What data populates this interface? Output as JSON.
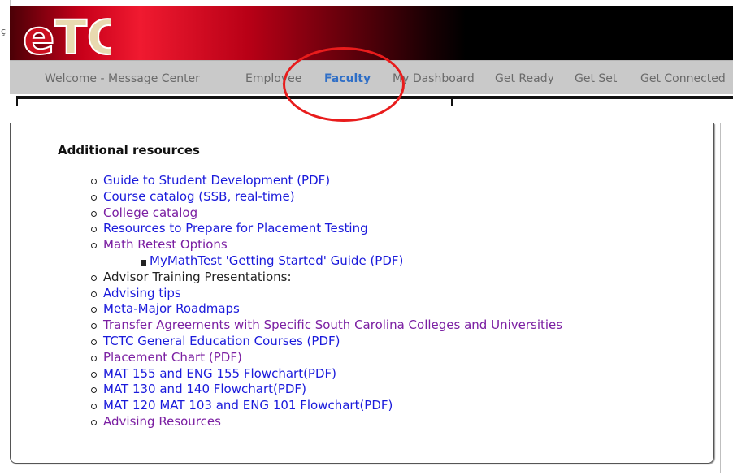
{
  "edge_char": "ç",
  "logo": {
    "text": "eTC",
    "red": "#cc1020",
    "cream": "#e8d9b0"
  },
  "nav": {
    "items": [
      {
        "label": "Welcome - Message Center",
        "active": false
      },
      {
        "label": "Employee",
        "active": false
      },
      {
        "label": "Faculty",
        "active": true
      },
      {
        "label": "My Dashboard",
        "active": false
      },
      {
        "label": "Get Ready",
        "active": false
      },
      {
        "label": "Get Set",
        "active": false
      },
      {
        "label": "Get Connected",
        "active": false
      }
    ]
  },
  "content": {
    "heading": "Additional resources",
    "items": [
      {
        "label": "Guide to Student Development (PDF)",
        "kind": "link"
      },
      {
        "label": "Course catalog (SSB, real-time)",
        "kind": "link"
      },
      {
        "label": "College catalog",
        "kind": "visited"
      },
      {
        "label": "Resources to Prepare for Placement Testing",
        "kind": "link"
      },
      {
        "label": "Math Retest Options",
        "kind": "visited"
      },
      {
        "label": "MyMathTest 'Getting Started' Guide (PDF)",
        "kind": "link",
        "sub": true
      },
      {
        "label": "Advisor Training Presentations:",
        "kind": "text"
      },
      {
        "label": "Advising tips",
        "kind": "link"
      },
      {
        "label": "Meta-Major Roadmaps",
        "kind": "link"
      },
      {
        "label": "Transfer Agreements with Specific South Carolina Colleges and Universities",
        "kind": "visited"
      },
      {
        "label": "TCTC General Education Courses (PDF)",
        "kind": "link"
      },
      {
        "label": "Placement Chart (PDF)",
        "kind": "visited"
      },
      {
        "label": "MAT 155 and ENG 155 Flowchart(PDF)",
        "kind": "link"
      },
      {
        "label": "MAT 130 and 140 Flowchart(PDF)",
        "kind": "link"
      },
      {
        "label": "MAT 120 MAT 103 and ENG 101 Flowchart(PDF)",
        "kind": "link"
      },
      {
        "label": "Advising Resources",
        "kind": "visited"
      }
    ]
  },
  "colors": {
    "link": "#1a1adb",
    "visited": "#7b1fa2",
    "nav_active": "#2f6fc7",
    "annotation": "#e81c1c"
  }
}
